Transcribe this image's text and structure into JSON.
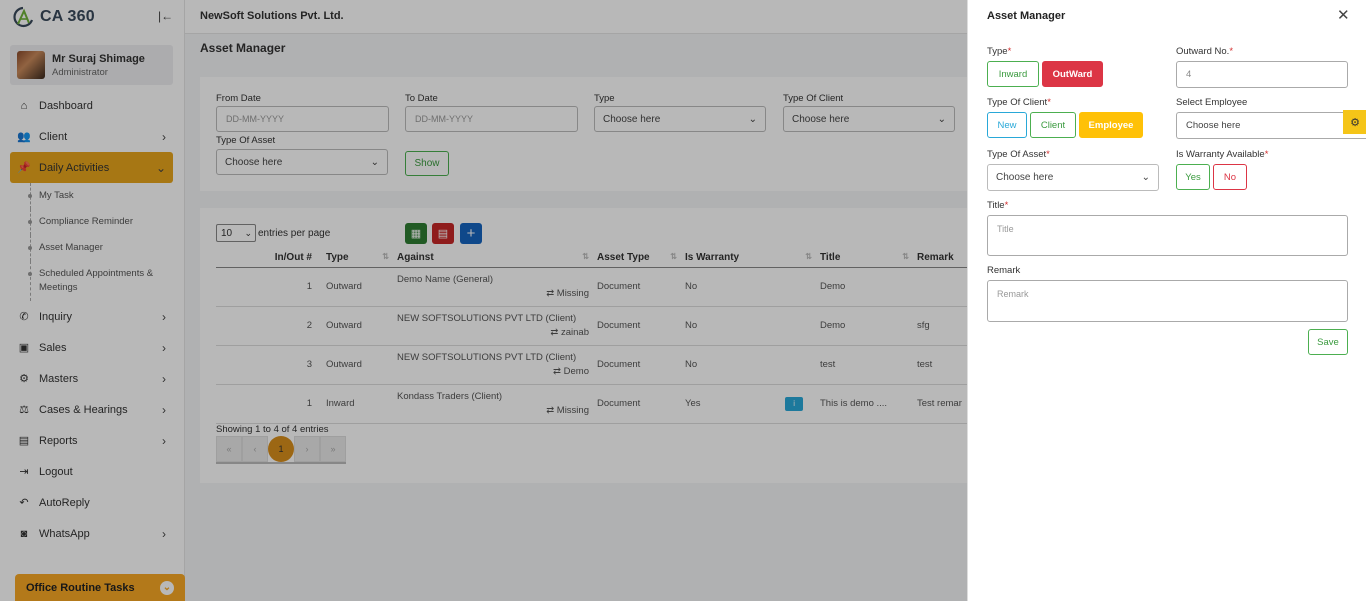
{
  "sidebar": {
    "logo_text": "CA 360",
    "user_name": "Mr Suraj Shimage",
    "user_role": "Administrator",
    "items": [
      {
        "label": "Dashboard",
        "icon": "home-icon",
        "chevron": false
      },
      {
        "label": "Client",
        "icon": "users-icon",
        "chevron": true
      },
      {
        "label": "Daily Activities",
        "icon": "pin-icon",
        "chevron": true,
        "active": true
      }
    ],
    "sub_items": [
      "My Task",
      "Compliance Reminder",
      "Asset Manager",
      "Scheduled Appointments & Meetings"
    ],
    "items_after": [
      {
        "label": "Inquiry",
        "icon": "phone-icon",
        "chevron": true
      },
      {
        "label": "Sales",
        "icon": "money-icon",
        "chevron": true
      },
      {
        "label": "Masters",
        "icon": "cogs-icon",
        "chevron": true
      },
      {
        "label": "Cases & Hearings",
        "icon": "scale-icon",
        "chevron": true
      },
      {
        "label": "Reports",
        "icon": "file-icon",
        "chevron": true
      },
      {
        "label": "Logout",
        "icon": "logout-icon",
        "chevron": false
      },
      {
        "label": "AutoReply",
        "icon": "reply-icon",
        "chevron": false
      },
      {
        "label": "WhatsApp",
        "icon": "whatsapp-icon",
        "chevron": true
      }
    ],
    "routine_label": "Office Routine Tasks"
  },
  "topbar": {
    "company": "NewSoft Solutions Pvt. Ltd."
  },
  "page": {
    "title": "Asset Manager"
  },
  "filters": {
    "from_date_label": "From Date",
    "from_date_placeholder": "DD-MM-YYYY",
    "to_date_label": "To Date",
    "to_date_placeholder": "DD-MM-YYYY",
    "type_label": "Type",
    "type_value": "Choose here",
    "client_type_label": "Type Of Client",
    "client_type_value": "Choose here",
    "asset_type_label": "Type Of Asset",
    "asset_type_value": "Choose here",
    "show_button": "Show"
  },
  "table": {
    "entries_value": "10",
    "entries_label": "entries per page",
    "columns": [
      "In/Out #",
      "Type",
      "Against",
      "Asset Type",
      "Is Warranty",
      "Title",
      "Remark"
    ],
    "rows": [
      {
        "num": "1",
        "type": "Outward",
        "against": "Demo Name (General)",
        "against_sub": "⇄ Missing",
        "asset_type": "Document",
        "warranty": "No",
        "info": false,
        "title": "Demo",
        "remark": ""
      },
      {
        "num": "2",
        "type": "Outward",
        "against": "NEW SOFTSOLUTIONS PVT LTD (Client)",
        "against_sub": "⇄ zainab",
        "asset_type": "Document",
        "warranty": "No",
        "info": false,
        "title": "Demo",
        "remark": "sfg"
      },
      {
        "num": "3",
        "type": "Outward",
        "against": "NEW SOFTSOLUTIONS PVT LTD (Client)",
        "against_sub": "⇄ Demo",
        "asset_type": "Document",
        "warranty": "No",
        "info": false,
        "title": "test",
        "remark": "test"
      },
      {
        "num": "1",
        "type": "Inward",
        "against": "Kondass Traders (Client)",
        "against_sub": "⇄ Missing",
        "asset_type": "Document",
        "warranty": "Yes",
        "info": true,
        "title": "This is demo ....",
        "remark": "Test remar"
      }
    ],
    "showing": "Showing 1 to 4 of 4 entries",
    "pages": [
      "«",
      "‹",
      "1",
      "›",
      "»"
    ]
  },
  "panel": {
    "title": "Asset Manager",
    "type_label": "Type",
    "inward_label": "Inward",
    "outward_label": "OutWard",
    "outward_no_label": "Outward No.",
    "outward_no_value": "4",
    "client_type_label": "Type Of Client",
    "new_label": "New",
    "client_label": "Client",
    "employee_label": "Employee",
    "select_employee_label": "Select Employee",
    "select_employee_value": "Choose here",
    "asset_type_label": "Type Of Asset",
    "asset_type_value": "Choose here",
    "warranty_label": "Is Warranty Available",
    "yes_label": "Yes",
    "no_label": "No",
    "title_label": "Title",
    "title_placeholder": "Title",
    "remark_label": "Remark",
    "remark_placeholder": "Remark",
    "save_label": "Save",
    "required_mark": "*"
  },
  "colors": {
    "accent": "#e8a61c",
    "danger": "#dc3545",
    "success": "#4caf50",
    "info": "#29a8d8",
    "warning": "#ffc107"
  }
}
